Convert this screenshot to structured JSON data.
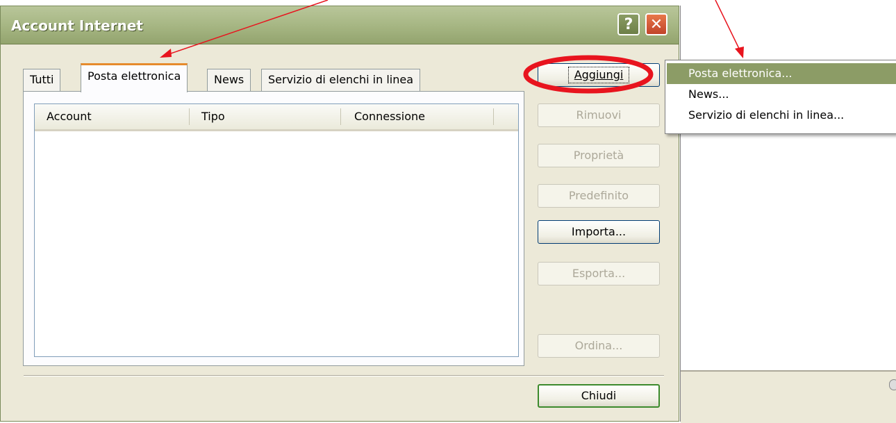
{
  "window": {
    "title": "Account Internet",
    "help_glyph": "?",
    "close_glyph": "✕"
  },
  "tabs": [
    {
      "label": "Tutti",
      "active": false
    },
    {
      "label": "Posta elettronica",
      "active": true
    },
    {
      "label": "News",
      "active": false
    },
    {
      "label": "Servizio di elenchi in linea",
      "active": false
    }
  ],
  "list": {
    "columns": [
      "Account",
      "Tipo",
      "Connessione"
    ],
    "rows": []
  },
  "buttons": {
    "add": "Aggiungi",
    "remove": "Rimuovi",
    "properties": "Proprietà",
    "default": "Predefinito",
    "import": "Importa...",
    "export": "Esporta...",
    "order": "Ordina...",
    "close": "Chiudi"
  },
  "menu": {
    "items": [
      "Posta elettronica...",
      "News...",
      "Servizio di elenchi in linea..."
    ],
    "selected_index": 0
  },
  "colors": {
    "title_bar": "#a7b784",
    "active_tab_accent": "#e68b2c",
    "menu_highlight": "#8c9c66",
    "annotation": "#e8141e"
  }
}
